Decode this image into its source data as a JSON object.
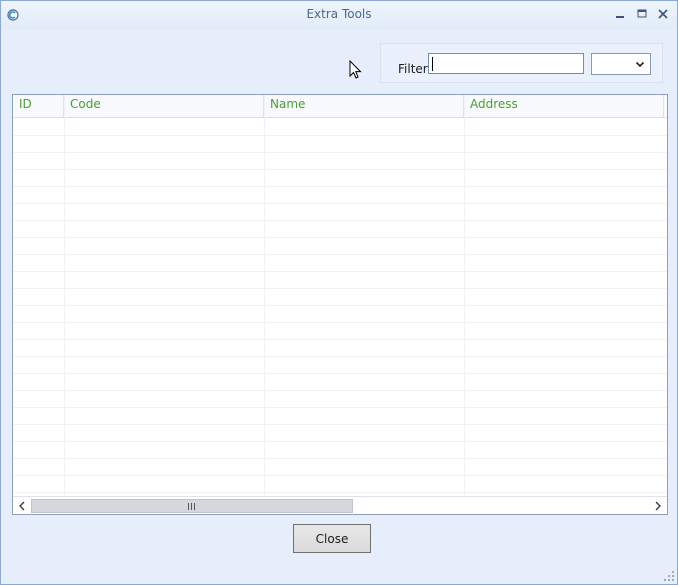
{
  "window": {
    "title": "Extra Tools",
    "controls": {
      "minimize_icon": "minimize-icon",
      "maximize_icon": "maximize-icon",
      "close_icon": "close-icon"
    }
  },
  "filter": {
    "label": "Filter",
    "value": "",
    "placeholder": "",
    "select_value": ""
  },
  "grid": {
    "columns": [
      "ID",
      "Code",
      "Name",
      "Address"
    ],
    "rows": []
  },
  "footer": {
    "close_label": "Close"
  },
  "colors": {
    "accent": "#4a6890",
    "header_text": "#4a9e33",
    "background": "#e6eefb"
  }
}
